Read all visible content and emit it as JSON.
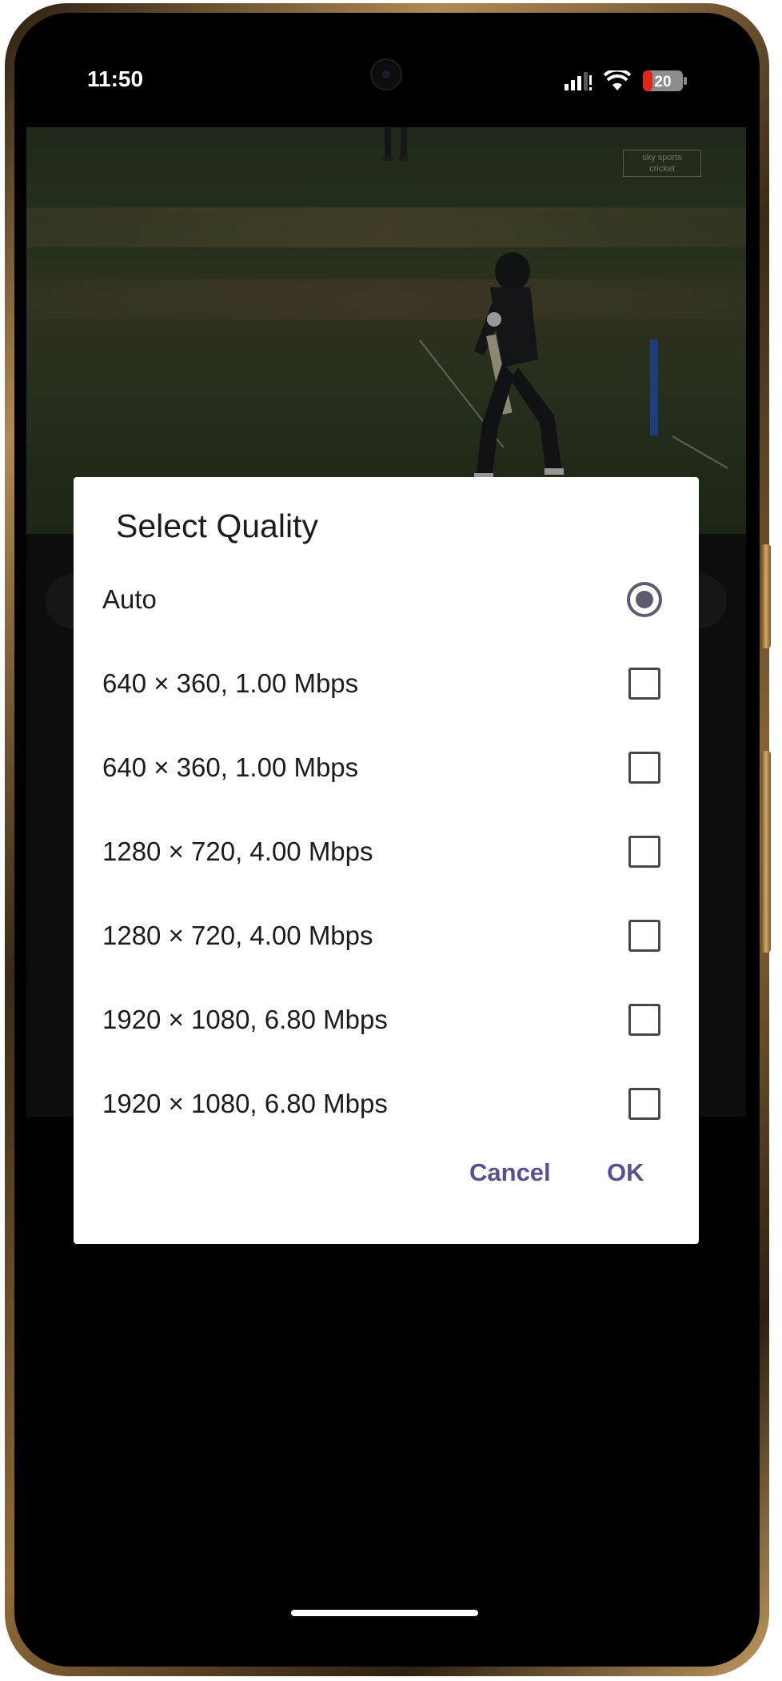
{
  "status_bar": {
    "time": "11:50",
    "battery_level": "20",
    "icons": [
      "signal-icon",
      "wifi-icon",
      "battery-icon"
    ]
  },
  "video": {
    "watermark_line1": "sky sports",
    "watermark_line2": "cricket"
  },
  "dialog": {
    "title": "Select Quality",
    "options": [
      {
        "label": "Auto",
        "selected": true
      },
      {
        "label": "640 × 360, 1.00 Mbps",
        "selected": false
      },
      {
        "label": "640 × 360, 1.00 Mbps",
        "selected": false
      },
      {
        "label": "1280 × 720, 4.00 Mbps",
        "selected": false
      },
      {
        "label": "1280 × 720, 4.00 Mbps",
        "selected": false
      },
      {
        "label": "1920 × 1080, 6.80 Mbps",
        "selected": false
      },
      {
        "label": "1920 × 1080, 6.80 Mbps",
        "selected": false
      }
    ],
    "cancel_label": "Cancel",
    "ok_label": "OK"
  },
  "colors": {
    "accent": "#5a4f91",
    "radio": "#5d5a72",
    "dialog_bg": "#ffffff",
    "screen_bg": "#000000"
  }
}
